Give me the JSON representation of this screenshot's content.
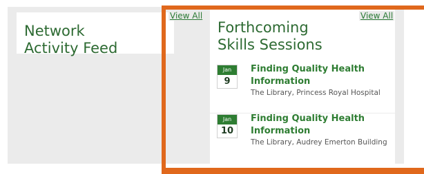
{
  "network_feed": {
    "title_line1": "Network",
    "title_line2": "Activity Feed",
    "view_all": "View All"
  },
  "skills_sessions": {
    "title_line1": "Forthcoming",
    "title_line2": "Skills Sessions",
    "view_all": "View All",
    "events": [
      {
        "month": "Jan",
        "day": "9",
        "title": "Finding Quality Health Information",
        "location": "The Library, Princess Royal Hospital"
      },
      {
        "month": "Jan",
        "day": "10",
        "title": "Finding Quality Health Information",
        "location": "The Library, Audrey Emerton Building"
      }
    ]
  },
  "colors": {
    "accent_green": "#2e7d32",
    "highlight_orange": "#e0681c",
    "panel_grey": "#ebebeb"
  }
}
